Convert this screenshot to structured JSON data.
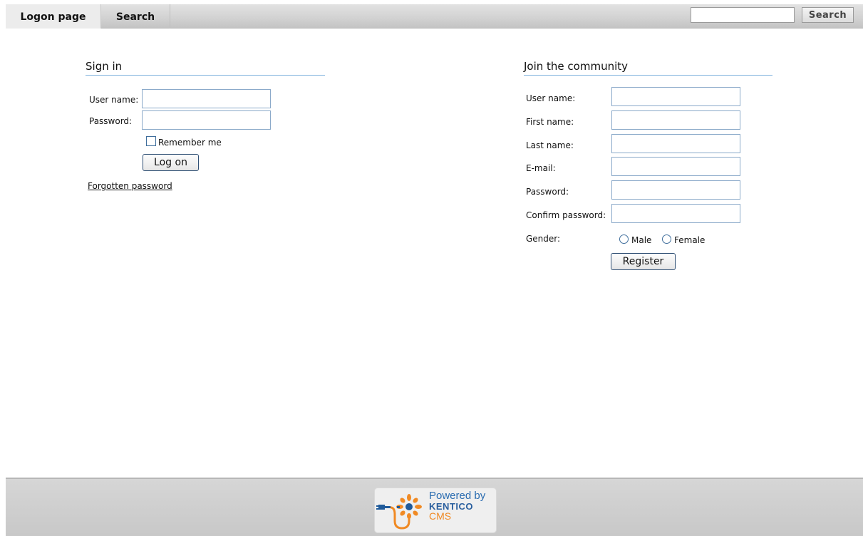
{
  "nav": {
    "tabs": [
      {
        "label": "Logon page",
        "active": true
      },
      {
        "label": "Search",
        "active": false
      }
    ],
    "search": {
      "value": "",
      "placeholder": "",
      "button_label": "Search"
    }
  },
  "signin": {
    "title": "Sign in",
    "username_label": "User name:",
    "username_value": "",
    "password_label": "Password:",
    "password_value": "",
    "remember_label": "Remember me",
    "remember_checked": false,
    "logon_label": "Log on",
    "forgot_label": "Forgotten password"
  },
  "join": {
    "title": "Join the community",
    "fields": [
      {
        "label": "User name:",
        "value": ""
      },
      {
        "label": "First name:",
        "value": ""
      },
      {
        "label": "Last name:",
        "value": ""
      },
      {
        "label": "E-mail:",
        "value": ""
      },
      {
        "label": "Password:",
        "value": ""
      },
      {
        "label": "Confirm password:",
        "value": ""
      }
    ],
    "gender_label": "Gender:",
    "gender_options": [
      "Male",
      "Female"
    ],
    "gender_selected": null,
    "register_label": "Register"
  },
  "footer": {
    "logo_text": {
      "powered": "Powered by",
      "brand": "KENTICO",
      "product": "CMS"
    }
  },
  "colors": {
    "heading_rule": "#7db0dc",
    "input_border": "#8aa9c9",
    "logo_blue": "#2a6cb0",
    "logo_orange": "#f08a24"
  }
}
